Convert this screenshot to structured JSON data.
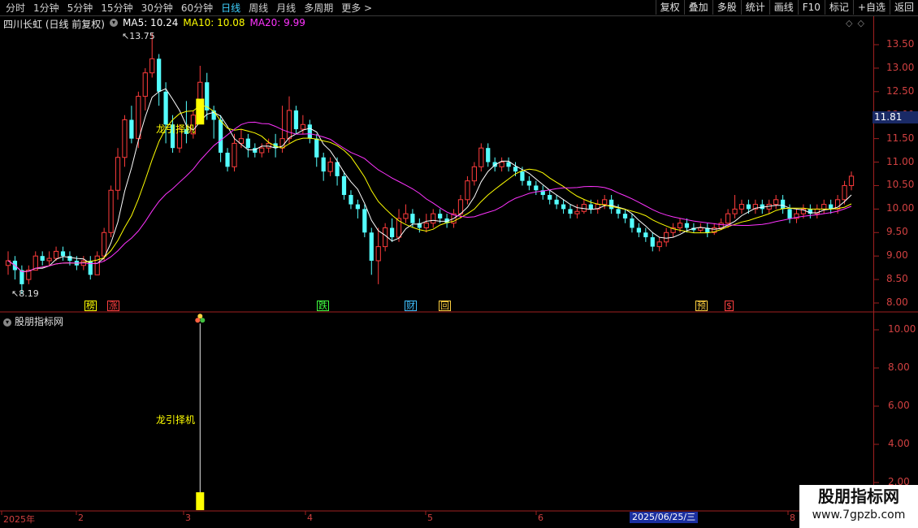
{
  "toolbar": {
    "left": [
      "分时",
      "1分钟",
      "5分钟",
      "15分钟",
      "30分钟",
      "60分钟",
      "日线",
      "周线",
      "月线",
      "多周期",
      "更多 >"
    ],
    "selected_index": 6,
    "right": [
      "复权",
      "叠加",
      "多股",
      "统计",
      "画线",
      "F10",
      "标记",
      "+自选",
      "返回"
    ]
  },
  "stock": {
    "name": "四川长虹 (日线 前复权)",
    "ma5_label": "MA5: 10.24",
    "ma10_label": "MA10: 10.08",
    "ma20_label": "MA20: 9.99"
  },
  "price_axis": [
    "13.50",
    "13.00",
    "12.50",
    "12.00",
    "11.50",
    "11.00",
    "10.50",
    "10.00",
    "9.50",
    "9.00",
    "8.50",
    "8.00"
  ],
  "current_price_tag": "11.81",
  "high_marker": "13.75",
  "low_marker": "8.19",
  "chart_annotation": "龙引择机",
  "event_markers": [
    "榜",
    "涨",
    "跌",
    "财",
    "回",
    "预",
    "$"
  ],
  "sub_panel": {
    "title": "股朋指标网",
    "annotation": "龙引择机",
    "axis": [
      "10.00",
      "8.00",
      "6.00",
      "4.00",
      "2.00"
    ]
  },
  "date_axis": {
    "labels": [
      "2025年",
      "2",
      "3",
      "4",
      "5",
      "6",
      "8"
    ],
    "cursor_date": "2025/06/25/三"
  },
  "watermark": {
    "title": "股朋指标网",
    "url": "www.7gpzb.com"
  },
  "colors": {
    "up": "#ff3c3c",
    "down": "#54ffff",
    "ma5": "#ffffff",
    "ma10": "#ffff00",
    "ma20": "#ff33ff",
    "signal": "#ffff00"
  },
  "chart_data": {
    "type": "candlestick",
    "ylim": [
      7.9,
      13.85
    ],
    "candles": [
      [
        8.8,
        8.9,
        9.1,
        8.6
      ],
      [
        8.9,
        8.7,
        9.0,
        8.5
      ],
      [
        8.7,
        8.4,
        8.8,
        8.19
      ],
      [
        8.5,
        8.7,
        8.8,
        8.4
      ],
      [
        8.7,
        9.0,
        9.1,
        8.7
      ],
      [
        9.0,
        8.9,
        9.1,
        8.8
      ],
      [
        8.9,
        8.95,
        9.1,
        8.8
      ],
      [
        8.95,
        9.1,
        9.2,
        8.9
      ],
      [
        9.1,
        9.0,
        9.2,
        8.9
      ],
      [
        9.0,
        8.9,
        9.1,
        8.8
      ],
      [
        8.9,
        8.8,
        9.0,
        8.7
      ],
      [
        8.8,
        8.9,
        9.0,
        8.7
      ],
      [
        8.9,
        8.6,
        9.0,
        8.5
      ],
      [
        8.6,
        9.0,
        9.1,
        8.6
      ],
      [
        9.0,
        9.5,
        9.6,
        8.9
      ],
      [
        9.5,
        10.4,
        10.5,
        9.4
      ],
      [
        10.4,
        11.1,
        11.3,
        10.2
      ],
      [
        11.1,
        11.9,
        12.0,
        10.9
      ],
      [
        11.9,
        11.5,
        12.2,
        11.4
      ],
      [
        11.5,
        12.4,
        12.5,
        11.3
      ],
      [
        12.4,
        12.9,
        13.0,
        12.1
      ],
      [
        12.9,
        13.2,
        13.75,
        12.8
      ],
      [
        13.2,
        12.5,
        13.3,
        12.2
      ],
      [
        12.5,
        11.8,
        12.7,
        11.4
      ],
      [
        11.8,
        11.3,
        12.0,
        11.2
      ],
      [
        11.3,
        11.7,
        11.8,
        11.2
      ],
      [
        11.7,
        11.6,
        12.3,
        11.4
      ],
      [
        11.6,
        12.0,
        12.1,
        11.5
      ],
      [
        12.0,
        12.7,
        13.05,
        11.9
      ],
      [
        12.7,
        12.1,
        12.9,
        11.9
      ],
      [
        12.1,
        11.9,
        12.2,
        11.5
      ],
      [
        11.9,
        11.2,
        12.0,
        11.0
      ],
      [
        11.2,
        10.9,
        11.3,
        10.8
      ],
      [
        10.9,
        11.4,
        11.6,
        10.8
      ],
      [
        11.4,
        11.5,
        11.7,
        11.3
      ],
      [
        11.5,
        11.3,
        11.6,
        11.1
      ],
      [
        11.3,
        11.2,
        11.4,
        11.1
      ],
      [
        11.2,
        11.3,
        11.4,
        11.1
      ],
      [
        11.3,
        11.4,
        11.5,
        11.2
      ],
      [
        11.4,
        11.3,
        11.6,
        11.1
      ],
      [
        11.3,
        11.5,
        12.2,
        11.2
      ],
      [
        11.5,
        12.1,
        12.4,
        11.4
      ],
      [
        12.1,
        11.7,
        12.2,
        11.6
      ],
      [
        11.7,
        11.8,
        12.0,
        11.6
      ],
      [
        11.8,
        11.5,
        11.9,
        11.4
      ],
      [
        11.5,
        11.1,
        11.6,
        10.9
      ],
      [
        11.1,
        10.8,
        11.2,
        10.6
      ],
      [
        10.8,
        11.0,
        11.1,
        10.7
      ],
      [
        11.0,
        10.7,
        11.1,
        10.5
      ],
      [
        10.7,
        10.3,
        10.8,
        10.2
      ],
      [
        10.3,
        10.1,
        10.4,
        10.0
      ],
      [
        10.1,
        10.0,
        10.2,
        9.8
      ],
      [
        10.0,
        9.5,
        10.1,
        9.4
      ],
      [
        9.5,
        8.9,
        9.6,
        8.6
      ],
      [
        8.9,
        9.2,
        9.6,
        8.4
      ],
      [
        9.2,
        9.6,
        9.7,
        9.1
      ],
      [
        9.6,
        9.4,
        9.8,
        9.3
      ],
      [
        9.4,
        9.8,
        10.0,
        9.3
      ],
      [
        9.8,
        9.9,
        10.1,
        9.7
      ],
      [
        9.9,
        9.7,
        10.0,
        9.6
      ],
      [
        9.7,
        9.6,
        9.8,
        9.5
      ],
      [
        9.6,
        9.7,
        9.9,
        9.5
      ],
      [
        9.7,
        9.9,
        10.0,
        9.6
      ],
      [
        9.9,
        9.8,
        10.0,
        9.7
      ],
      [
        9.8,
        9.7,
        9.9,
        9.6
      ],
      [
        9.7,
        9.9,
        10.0,
        9.6
      ],
      [
        9.9,
        10.2,
        10.3,
        9.8
      ],
      [
        10.2,
        10.6,
        10.7,
        10.1
      ],
      [
        10.6,
        10.9,
        11.0,
        10.5
      ],
      [
        10.9,
        11.3,
        11.4,
        10.8
      ],
      [
        11.3,
        11.0,
        11.4,
        10.9
      ],
      [
        11.0,
        10.9,
        11.1,
        10.8
      ],
      [
        10.9,
        11.0,
        11.1,
        10.8
      ],
      [
        11.0,
        10.9,
        11.1,
        10.8
      ],
      [
        10.9,
        10.8,
        11.0,
        10.7
      ],
      [
        10.8,
        10.6,
        10.9,
        10.5
      ],
      [
        10.6,
        10.5,
        10.7,
        10.4
      ],
      [
        10.5,
        10.4,
        10.6,
        10.3
      ],
      [
        10.4,
        10.3,
        10.5,
        10.2
      ],
      [
        10.3,
        10.2,
        10.4,
        10.1
      ],
      [
        10.2,
        10.1,
        10.3,
        10.0
      ],
      [
        10.1,
        10.0,
        10.2,
        9.9
      ],
      [
        10.0,
        9.9,
        10.1,
        9.8
      ],
      [
        9.9,
        9.95,
        10.1,
        9.8
      ],
      [
        9.95,
        10.1,
        10.2,
        9.9
      ],
      [
        10.1,
        10.0,
        10.2,
        9.9
      ],
      [
        10.0,
        10.1,
        10.2,
        9.9
      ],
      [
        10.1,
        10.2,
        10.3,
        10.0
      ],
      [
        10.2,
        10.0,
        10.3,
        9.9
      ],
      [
        10.0,
        9.9,
        10.1,
        9.8
      ],
      [
        9.9,
        9.8,
        10.0,
        9.7
      ],
      [
        9.8,
        9.6,
        9.9,
        9.5
      ],
      [
        9.6,
        9.5,
        9.7,
        9.4
      ],
      [
        9.5,
        9.4,
        9.6,
        9.3
      ],
      [
        9.4,
        9.2,
        9.5,
        9.1
      ],
      [
        9.2,
        9.3,
        9.4,
        9.1
      ],
      [
        9.3,
        9.5,
        9.6,
        9.2
      ],
      [
        9.5,
        9.6,
        9.7,
        9.4
      ],
      [
        9.6,
        9.7,
        9.8,
        9.5
      ],
      [
        9.7,
        9.6,
        9.8,
        9.5
      ],
      [
        9.6,
        9.55,
        9.7,
        9.5
      ],
      [
        9.55,
        9.6,
        9.7,
        9.5
      ],
      [
        9.6,
        9.5,
        9.7,
        9.4
      ],
      [
        9.5,
        9.6,
        9.7,
        9.45
      ],
      [
        9.6,
        9.7,
        9.8,
        9.55
      ],
      [
        9.7,
        9.9,
        10.0,
        9.6
      ],
      [
        9.9,
        10.0,
        10.3,
        9.8
      ],
      [
        10.0,
        10.1,
        10.2,
        9.9
      ],
      [
        10.1,
        10.0,
        10.2,
        9.9
      ],
      [
        10.0,
        10.1,
        10.2,
        9.9
      ],
      [
        10.1,
        10.0,
        10.2,
        9.9
      ],
      [
        10.0,
        10.1,
        10.2,
        9.9
      ],
      [
        10.1,
        10.2,
        10.3,
        10.0
      ],
      [
        10.2,
        10.0,
        10.3,
        9.9
      ],
      [
        10.0,
        9.8,
        10.1,
        9.7
      ],
      [
        9.8,
        9.9,
        10.0,
        9.7
      ],
      [
        9.9,
        10.0,
        10.1,
        9.8
      ],
      [
        10.0,
        9.9,
        10.1,
        9.8
      ],
      [
        9.9,
        10.0,
        10.1,
        9.8
      ],
      [
        10.0,
        10.1,
        10.2,
        9.9
      ],
      [
        10.1,
        10.0,
        10.2,
        9.9
      ],
      [
        10.0,
        10.2,
        10.3,
        9.9
      ],
      [
        10.2,
        10.5,
        10.6,
        10.1
      ],
      [
        10.5,
        10.7,
        10.8,
        10.4
      ]
    ],
    "signal_bar": {
      "index": 28,
      "price_top": 12.35,
      "price_bottom": 11.8,
      "sub_value": 10.5
    }
  }
}
